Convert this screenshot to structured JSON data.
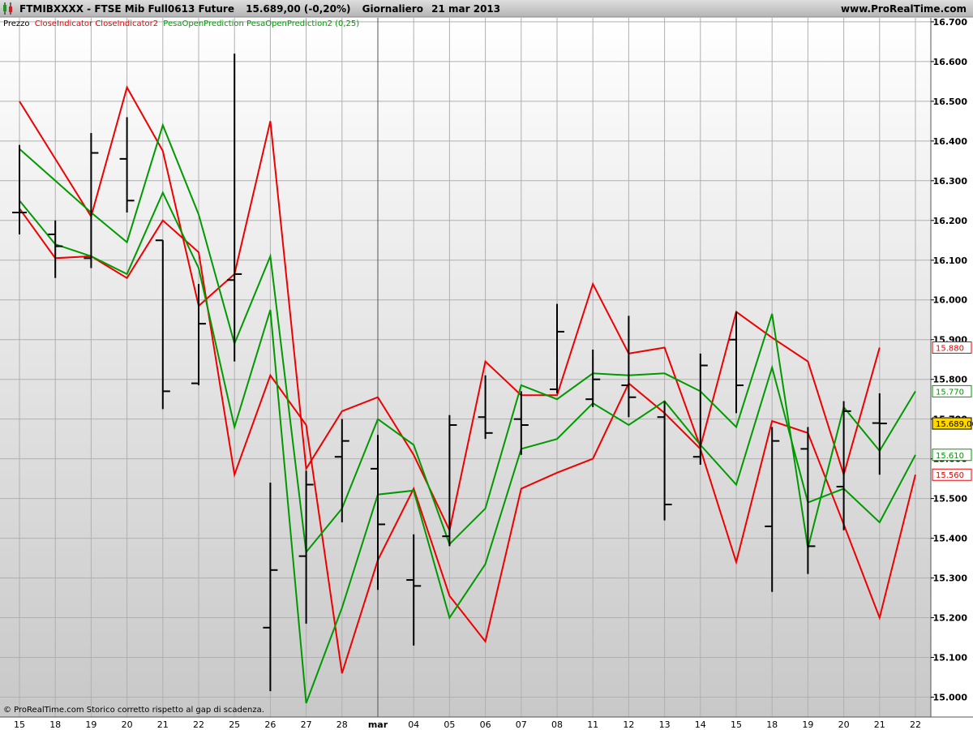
{
  "header": {
    "symbol": "FTMIBXXXX",
    "instrument": "FTSE Mib Full0613 Future",
    "last_price": "15.689,00 (-0,20%)",
    "period": "Giornaliero",
    "date": "21 mar 2013",
    "site": "www.ProRealTime.com",
    "bg_color": "#c0c0c0"
  },
  "legend": {
    "price_label": "Prezzo",
    "indicator1_label": "CloseIndicator CloseIndicator2",
    "indicator1_color": "#ee0000",
    "indicator2_label": "PesaOpenPrediction PesaOpenPrediction2 (0,25)",
    "indicator2_color": "#009900"
  },
  "footer": {
    "note": "© ProRealTime.com  Storico corretto rispetto al gap di scadenza."
  },
  "last_labels": [
    {
      "text": "15.880",
      "color": "#ee0000"
    },
    {
      "text": "15.770",
      "color": "#009900"
    },
    {
      "text": "15.689,00",
      "color": "#000000",
      "bg": "#ffd700"
    },
    {
      "text": "15.610",
      "color": "#009900"
    },
    {
      "text": "15.560",
      "color": "#ee0000"
    }
  ],
  "chart_data": {
    "type": "line",
    "title": "",
    "y_axis_position": "right",
    "ylim": [
      14950,
      16710
    ],
    "y_ticks": [
      15000,
      15100,
      15200,
      15300,
      15400,
      15500,
      15600,
      15700,
      15800,
      15900,
      16000,
      16100,
      16200,
      16300,
      16400,
      16500,
      16600,
      16700
    ],
    "y_tick_labels": [
      "15.000",
      "15.100",
      "15.200",
      "15.300",
      "15.400",
      "15.500",
      "15.600",
      "15.700",
      "15.800",
      "15.900",
      "16.000",
      "16.100",
      "16.200",
      "16.300",
      "16.400",
      "16.500",
      "16.600",
      "16.700"
    ],
    "y_major_ticks": [
      15000,
      15500,
      16000,
      16500
    ],
    "x_tick_labels": [
      "15",
      "18",
      "19",
      "20",
      "21",
      "22",
      "25",
      "26",
      "27",
      "28",
      "mar",
      "04",
      "05",
      "06",
      "07",
      "08",
      "11",
      "12",
      "13",
      "14",
      "15",
      "18",
      "19",
      "20",
      "21",
      "22"
    ],
    "month_separator_index": 10,
    "grid": true,
    "background_gradient": [
      "#ffffff",
      "#c8c8c8"
    ],
    "price_bars": {
      "name": "Prezzo",
      "color": "#000000",
      "open": [
        16220,
        16165,
        16105,
        16355,
        16150,
        15790,
        16050,
        15175,
        15355,
        15605,
        15575,
        15295,
        15405,
        15705,
        15700,
        15775,
        15750,
        15785,
        15705,
        15605,
        15900,
        15430,
        15625,
        15530,
        15690
      ],
      "high": [
        16390,
        16200,
        16420,
        16460,
        16150,
        16040,
        16620,
        15540,
        15570,
        15700,
        15660,
        15410,
        15710,
        15810,
        15770,
        15990,
        15875,
        15960,
        15745,
        15865,
        15970,
        15680,
        15680,
        15745,
        15765
      ],
      "low": [
        16165,
        16055,
        16080,
        16220,
        15725,
        15785,
        15845,
        15015,
        15185,
        15440,
        15270,
        15130,
        15380,
        15650,
        15610,
        15765,
        15730,
        15705,
        15445,
        15585,
        15715,
        15265,
        15310,
        15420,
        15560
      ],
      "close": [
        16220,
        16135,
        16370,
        16250,
        15770,
        15940,
        16065,
        15320,
        15535,
        15645,
        15435,
        15280,
        15685,
        15665,
        15685,
        15920,
        15800,
        15755,
        15485,
        15835,
        15785,
        15645,
        15380,
        15720,
        15689
      ]
    },
    "series": [
      {
        "name": "CloseIndicator",
        "color": "#ee0000",
        "values": [
          16500,
          16355,
          16210,
          16535,
          16375,
          15985,
          16065,
          16450,
          15575,
          15720,
          15755,
          15610,
          15420,
          15845,
          15760,
          15760,
          16040,
          15865,
          15880,
          15630,
          15970,
          15905,
          15845,
          15560,
          15880
        ]
      },
      {
        "name": "CloseIndicator2",
        "color": "#ee0000",
        "values": [
          16230,
          16105,
          16110,
          16055,
          16200,
          16120,
          15560,
          15810,
          15685,
          15060,
          15345,
          15525,
          15255,
          15140,
          15525,
          15565,
          15600,
          15790,
          15715,
          15625,
          15340,
          15695,
          15665,
          15435,
          15200,
          15560
        ]
      },
      {
        "name": "PesaOpenPrediction",
        "color": "#009900",
        "values": [
          16380,
          16300,
          16220,
          16145,
          16440,
          16215,
          15890,
          16110,
          15365,
          15475,
          15700,
          15635,
          15385,
          15475,
          15785,
          15750,
          15815,
          15810,
          15815,
          15770,
          15680,
          15965,
          15375,
          15730,
          15620,
          15770
        ]
      },
      {
        "name": "PesaOpenPrediction2",
        "color": "#009900",
        "values": [
          16250,
          16140,
          16110,
          16065,
          16270,
          16080,
          15680,
          15975,
          14985,
          15225,
          15510,
          15520,
          15200,
          15335,
          15625,
          15650,
          15740,
          15685,
          15745,
          15635,
          15535,
          15830,
          15490,
          15525,
          15440,
          15610
        ]
      }
    ]
  }
}
